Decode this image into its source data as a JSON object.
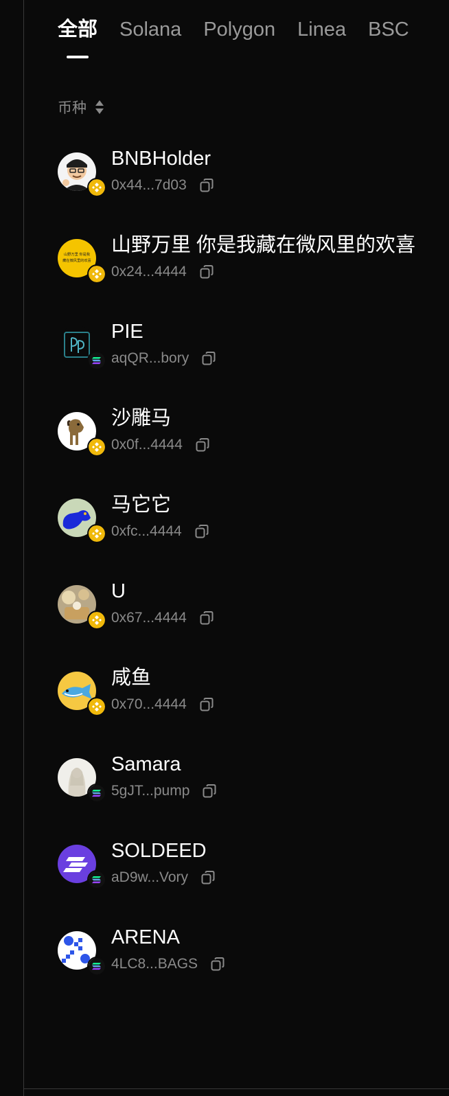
{
  "tabs": [
    {
      "label": "全部",
      "active": true
    },
    {
      "label": "Solana",
      "active": false
    },
    {
      "label": "Polygon",
      "active": false
    },
    {
      "label": "Linea",
      "active": false
    },
    {
      "label": "BSC",
      "active": false
    }
  ],
  "sort_header": {
    "label": "币种",
    "icon": "sort-updown-icon"
  },
  "tokens": [
    {
      "name": "BNBHolder",
      "address": "0x44...7d03",
      "chain": "bnb",
      "avatar": "cartoon-man-avatar"
    },
    {
      "name": "山野万里 你是我藏在微风里的欢喜",
      "address": "0x24...4444",
      "chain": "bnb",
      "avatar": "yellow-text-avatar",
      "avatar_text_1": "山野万里 你是我",
      "avatar_text_2": "藏在微风里的欢喜"
    },
    {
      "name": "PIE",
      "address": "aqQR...bory",
      "chain": "solana",
      "avatar": "pie-logo-avatar"
    },
    {
      "name": "沙雕马",
      "address": "0x0f...4444",
      "chain": "bnb",
      "avatar": "horse-avatar"
    },
    {
      "name": "马它它",
      "address": "0xfc...4444",
      "chain": "bnb",
      "avatar": "blue-horse-avatar"
    },
    {
      "name": "U",
      "address": "0x67...4444",
      "chain": "bnb",
      "avatar": "photo-avatar"
    },
    {
      "name": "咸鱼",
      "address": "0x70...4444",
      "chain": "bnb",
      "avatar": "fish-avatar"
    },
    {
      "name": "Samara",
      "address": "5gJT...pump",
      "chain": "solana",
      "avatar": "white-figure-avatar"
    },
    {
      "name": "SOLDEED",
      "address": "aD9w...Vory",
      "chain": "solana",
      "avatar": "purple-stripes-avatar"
    },
    {
      "name": "ARENA",
      "address": "4LC8...BAGS",
      "chain": "solana",
      "avatar": "blue-dots-avatar"
    }
  ],
  "colors": {
    "background": "#0a0a0a",
    "text_primary": "#ffffff",
    "text_secondary": "#8a8a8a",
    "bnb_gold": "#f0b90b",
    "solana_purple": "#9945ff",
    "solana_green": "#14f195"
  }
}
